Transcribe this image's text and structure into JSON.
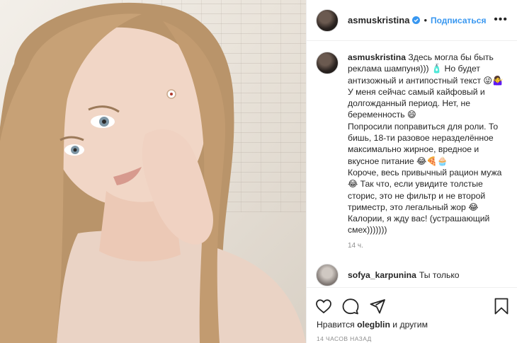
{
  "post": {
    "image_alt": "selfie photo",
    "author": {
      "username": "asmuskristina",
      "verified": true,
      "follow_label": "Подписаться"
    },
    "more_label": "•••",
    "caption": {
      "username": "asmuskristina",
      "text": "Здесь могла бы быть реклама шампуня))) 🧴 Но будет антизожный и антипостный текст 😜🤷‍♀️ У меня сейчас самый кайфовый и долгожданный период. Нет, не беременность 😄\nПопросили поправиться для роли. То бишь, 18-ти разовое неразделённое максимально жирное, вредное и вкусное питание 😂🍕🧁\nКороче, весь привычный рацион мужа 😂 Так что, если увидите толстые сторис, это не фильтр и не второй триместр, это легальный жор 😂 Калории, я жду вас! (устрашающий смех)))))))",
      "time": "14 ч."
    },
    "comment": {
      "username": "sofya_karpunina",
      "text": "Ты только"
    },
    "likes": {
      "prefix": "Нравится",
      "user": "olegblin",
      "suffix": "и другим"
    },
    "time_ago": "14 часов назад"
  },
  "icons": [
    "heart-icon",
    "comment-icon",
    "share-icon",
    "bookmark-icon",
    "verified-icon"
  ],
  "colors": {
    "accent": "#3897f0",
    "text": "#262626",
    "muted": "#8e8e8e",
    "border": "#efefef"
  }
}
